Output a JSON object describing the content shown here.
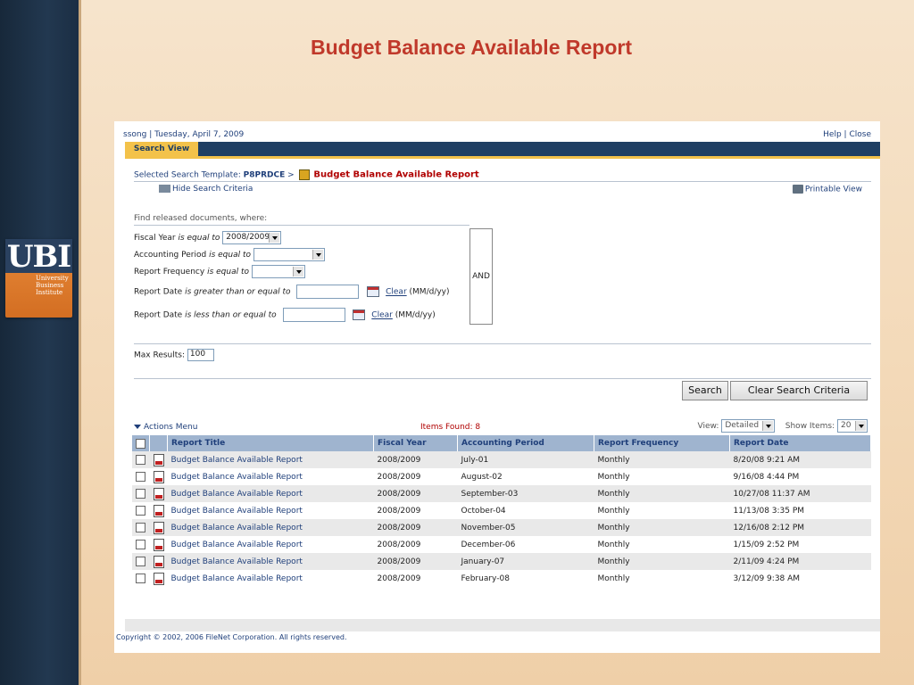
{
  "slide_title": "Budget Balance Available Report",
  "logo": {
    "text": "UBI",
    "line1": "University",
    "line2": "Business",
    "line3": "Institute"
  },
  "header": {
    "user": "ssong",
    "date": "Tuesday, April 7, 2009",
    "help": "Help",
    "close": "Close",
    "sep": "|"
  },
  "tab": {
    "label": "Search View"
  },
  "template": {
    "label": "Selected Search Template:",
    "code": "P8PRDCE",
    "sep": ">",
    "name": "Budget Balance Available Report"
  },
  "links": {
    "hide_criteria": "Hide Search Criteria",
    "printable_view": "Printable View"
  },
  "criteria": {
    "intro": "Find released documents, where:",
    "fiscal_year": {
      "label": "Fiscal Year",
      "op": "is equal to",
      "value": "2008/2009"
    },
    "accounting_period": {
      "label": "Accounting Period",
      "op": "is equal to",
      "value": ""
    },
    "report_frequency": {
      "label": "Report Frequency",
      "op": "is equal to",
      "value": ""
    },
    "date_from": {
      "label": "Report Date",
      "op": "is greater than or equal to",
      "value": "",
      "clear": "Clear",
      "format": "(MM/d/yy)"
    },
    "date_to": {
      "label": "Report Date",
      "op": "is less than or equal to",
      "value": "",
      "clear": "Clear",
      "format": "(MM/d/yy)"
    },
    "and_label": "AND"
  },
  "max_results": {
    "label": "Max Results:",
    "value": "100"
  },
  "buttons": {
    "search": "Search",
    "clear": "Clear Search Criteria"
  },
  "results": {
    "actions_menu": "Actions Menu",
    "items_found": "Items Found: 8",
    "view_label": "View:",
    "view_value": "Detailed",
    "show_label": "Show Items:",
    "show_value": "20",
    "columns": [
      "Report Title",
      "Fiscal Year",
      "Accounting Period",
      "Report Frequency",
      "Report Date"
    ],
    "rows": [
      {
        "title": "Budget Balance Available Report",
        "fy": "2008/2009",
        "period": "July-01",
        "freq": "Monthly",
        "date": "8/20/08 9:21 AM"
      },
      {
        "title": "Budget Balance Available Report",
        "fy": "2008/2009",
        "period": "August-02",
        "freq": "Monthly",
        "date": "9/16/08 4:44 PM"
      },
      {
        "title": "Budget Balance Available Report",
        "fy": "2008/2009",
        "period": "September-03",
        "freq": "Monthly",
        "date": "10/27/08 11:37 AM"
      },
      {
        "title": "Budget Balance Available Report",
        "fy": "2008/2009",
        "period": "October-04",
        "freq": "Monthly",
        "date": "11/13/08 3:35 PM"
      },
      {
        "title": "Budget Balance Available Report",
        "fy": "2008/2009",
        "period": "November-05",
        "freq": "Monthly",
        "date": "12/16/08 2:12 PM"
      },
      {
        "title": "Budget Balance Available Report",
        "fy": "2008/2009",
        "period": "December-06",
        "freq": "Monthly",
        "date": "1/15/09 2:52 PM"
      },
      {
        "title": "Budget Balance Available Report",
        "fy": "2008/2009",
        "period": "January-07",
        "freq": "Monthly",
        "date": "2/11/09 4:24 PM"
      },
      {
        "title": "Budget Balance Available Report",
        "fy": "2008/2009",
        "period": "February-08",
        "freq": "Monthly",
        "date": "3/12/09 9:38 AM"
      }
    ]
  },
  "footer": {
    "copyright": "Copyright © 2002, 2006 FileNet Corporation. All rights reserved."
  }
}
